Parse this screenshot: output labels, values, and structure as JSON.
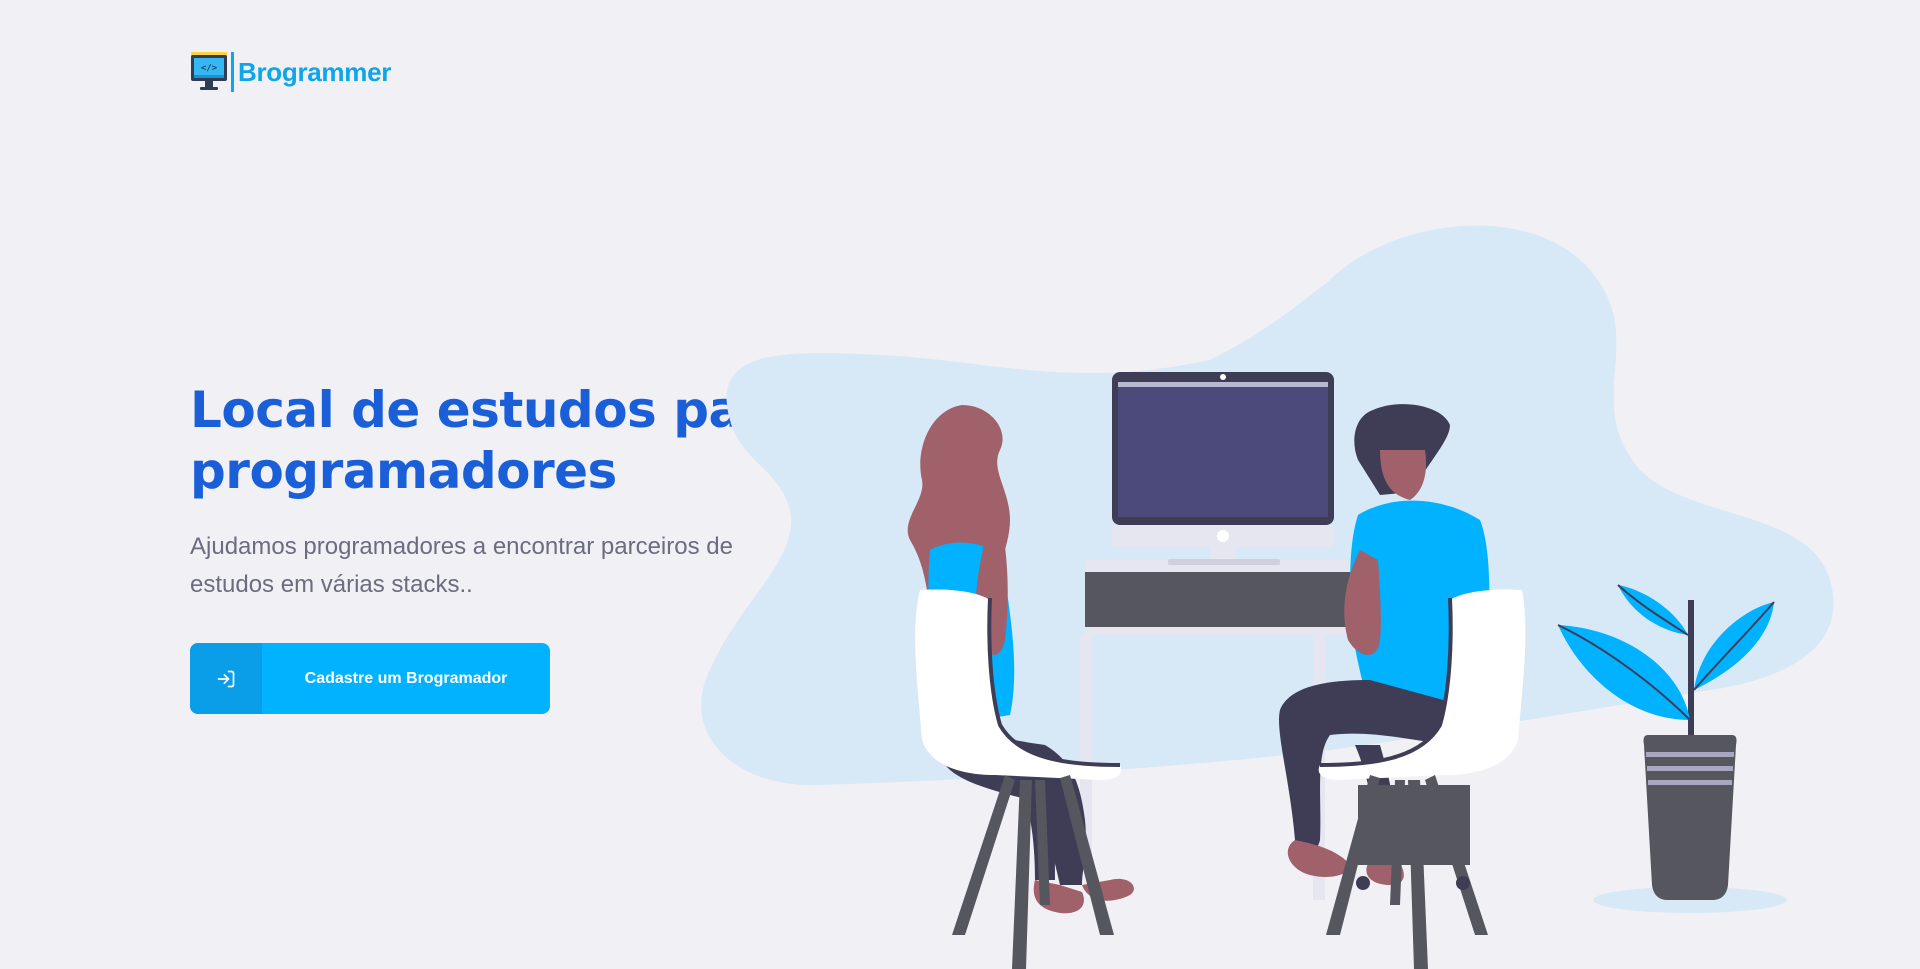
{
  "header": {
    "logo_text": "Brogrammer",
    "logo_icon": "monitor-code-icon"
  },
  "hero": {
    "title": "Local de estudos para programadores",
    "description": "Ajudamos programadores a encontrar parceiros de estudos em várias stacks..",
    "cta_label": "Cadastre um Brogramador",
    "cta_icon": "sign-in-icon"
  },
  "illustration": {
    "name": "two-programmers-at-desk-illustration"
  },
  "colors": {
    "background": "#F0F0F5",
    "title": "#1A5FD8",
    "accent": "#00B2FF",
    "accent_dark": "#0A9EE8",
    "text_muted": "#6C6C80",
    "blob": "#D7E8F6"
  }
}
